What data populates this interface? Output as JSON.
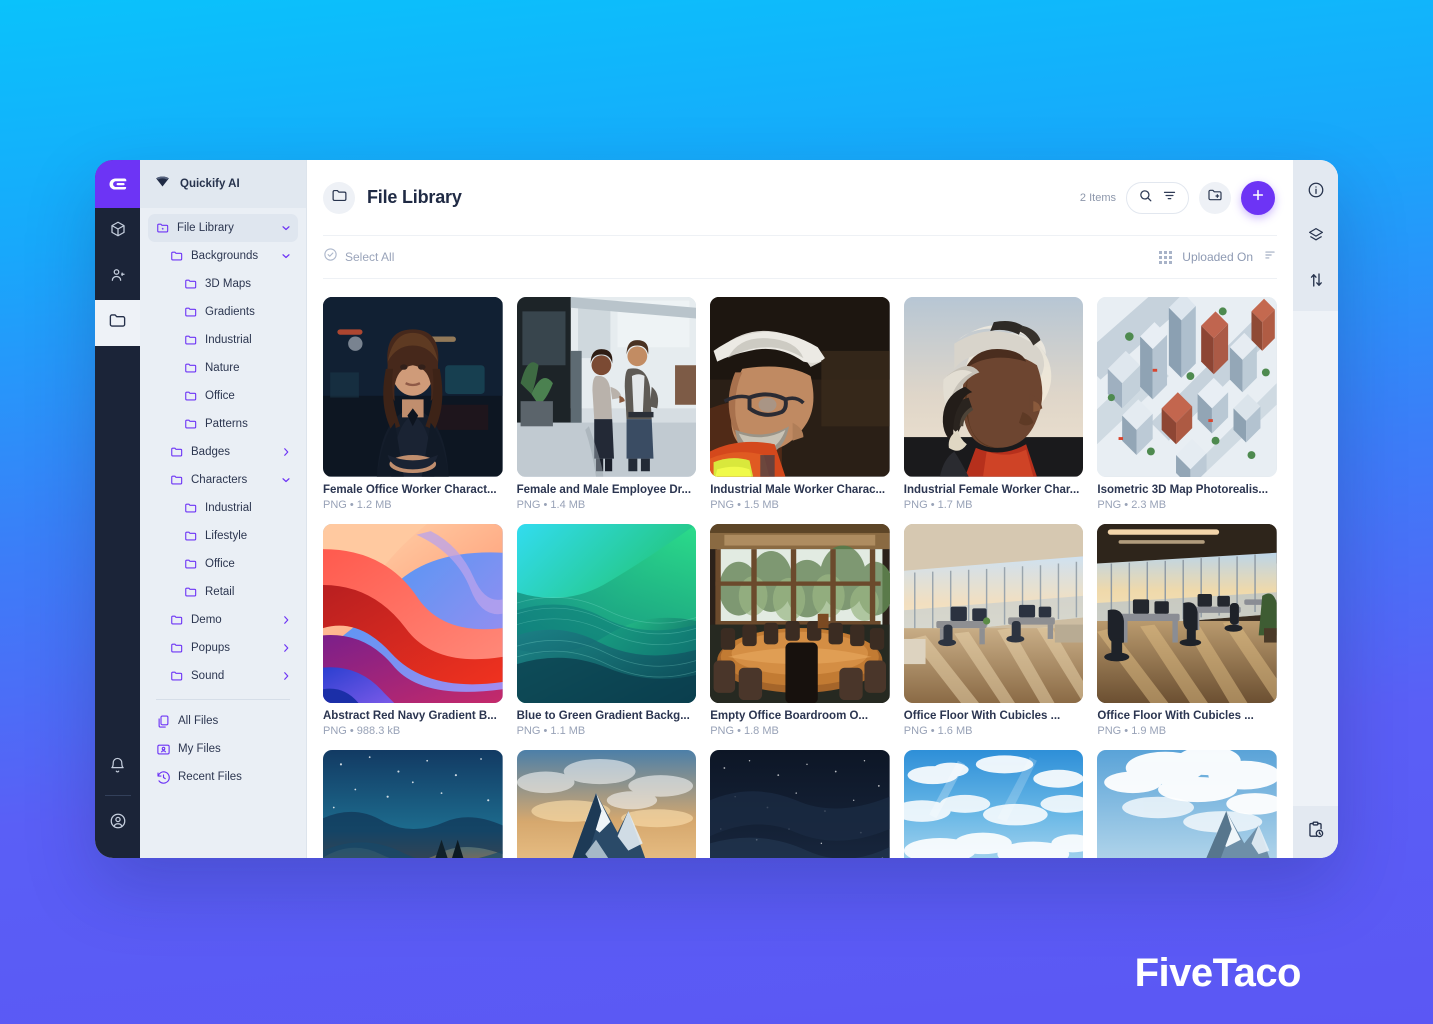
{
  "background": {
    "from": "#0ac2fb",
    "to": "#5b57f4"
  },
  "watermark": {
    "text": "FiveTaco"
  },
  "brand": {
    "name": "Quickify AI",
    "accent": "#6d34f5"
  },
  "left_rail": {
    "items": [
      {
        "name": "logo",
        "icon": "quickify-logo-icon"
      },
      {
        "name": "cube",
        "icon": "cube-icon"
      },
      {
        "name": "people",
        "icon": "people-icon"
      },
      {
        "name": "folder",
        "icon": "folder-icon",
        "active": true
      }
    ],
    "bottom": [
      {
        "name": "notifications",
        "icon": "bell-icon"
      },
      {
        "name": "account",
        "icon": "user-circle-icon"
      }
    ]
  },
  "sidebar": {
    "tree": [
      {
        "label": "File Library",
        "depth": 1,
        "icon": "folder-star-icon",
        "chevron": "down",
        "selected": true
      },
      {
        "label": "Backgrounds",
        "depth": 2,
        "icon": "folder-icon",
        "chevron": "down"
      },
      {
        "label": "3D Maps",
        "depth": 3,
        "icon": "folder-icon",
        "chevron": "none"
      },
      {
        "label": "Gradients",
        "depth": 3,
        "icon": "folder-icon",
        "chevron": "none"
      },
      {
        "label": "Industrial",
        "depth": 3,
        "icon": "folder-icon",
        "chevron": "none"
      },
      {
        "label": "Nature",
        "depth": 3,
        "icon": "folder-icon",
        "chevron": "none"
      },
      {
        "label": "Office",
        "depth": 3,
        "icon": "folder-icon",
        "chevron": "none"
      },
      {
        "label": "Patterns",
        "depth": 3,
        "icon": "folder-icon",
        "chevron": "none"
      },
      {
        "label": "Badges",
        "depth": 2,
        "icon": "folder-icon",
        "chevron": "right"
      },
      {
        "label": "Characters",
        "depth": 2,
        "icon": "folder-icon",
        "chevron": "down"
      },
      {
        "label": "Industrial",
        "depth": 3,
        "icon": "folder-icon",
        "chevron": "none"
      },
      {
        "label": "Lifestyle",
        "depth": 3,
        "icon": "folder-icon",
        "chevron": "none"
      },
      {
        "label": "Office",
        "depth": 3,
        "icon": "folder-icon",
        "chevron": "none"
      },
      {
        "label": "Retail",
        "depth": 3,
        "icon": "folder-icon",
        "chevron": "none"
      },
      {
        "label": "Demo",
        "depth": 2,
        "icon": "folder-icon",
        "chevron": "right"
      },
      {
        "label": "Popups",
        "depth": 2,
        "icon": "folder-icon",
        "chevron": "right"
      },
      {
        "label": "Sound",
        "depth": 2,
        "icon": "folder-icon",
        "chevron": "right"
      }
    ],
    "links": [
      {
        "label": "All Files",
        "icon": "copy-files-icon"
      },
      {
        "label": "My Files",
        "icon": "my-files-icon"
      },
      {
        "label": "Recent Files",
        "icon": "history-clock-icon"
      }
    ]
  },
  "header": {
    "title": "File Library",
    "folder_icon": "folder-icon",
    "item_count": "2 Items",
    "search_icon": "search-icon",
    "filter_icon": "filter-icon",
    "new_folder_icon": "folder-add-icon",
    "add_icon": "plus-icon"
  },
  "subbar": {
    "select_all": "Select All",
    "select_all_icon": "check-circle-icon",
    "view_icon": "grid-view-icon",
    "sort_label": "Uploaded On",
    "sort_icon": "sort-descending-icon"
  },
  "right_rail": {
    "items": [
      {
        "name": "info",
        "icon": "info-circle-icon"
      },
      {
        "name": "layers",
        "icon": "layers-icon"
      },
      {
        "name": "sort",
        "icon": "arrows-up-down-icon"
      }
    ],
    "footer": {
      "name": "activity",
      "icon": "clipboard-clock-icon"
    }
  },
  "files": [
    {
      "name": "Female Office Worker Charact...",
      "meta": "PNG • 1.2 MB",
      "thumb": "portrait-businesswoman"
    },
    {
      "name": "Female and Male Employee Dr...",
      "meta": "PNG • 1.4 MB",
      "thumb": "office-lobby-two-people"
    },
    {
      "name": "Industrial Male Worker Charac...",
      "meta": "PNG • 1.5 MB",
      "thumb": "male-hardhat-worker"
    },
    {
      "name": "Industrial Female Worker Char...",
      "meta": "PNG • 1.7 MB",
      "thumb": "female-hardhat-worker"
    },
    {
      "name": "Isometric 3D Map Photorealis...",
      "meta": "PNG • 2.3 MB",
      "thumb": "isometric-city-map"
    },
    {
      "name": "Abstract Red Navy Gradient B...",
      "meta": "PNG • 988.3 kB",
      "thumb": "red-navy-gradient"
    },
    {
      "name": "Blue to Green Gradient Backg...",
      "meta": "PNG • 1.1 MB",
      "thumb": "blue-green-gradient"
    },
    {
      "name": "Empty Office Boardroom O...",
      "meta": "PNG • 1.8 MB",
      "thumb": "boardroom"
    },
    {
      "name": "Office Floor With Cubicles ...",
      "meta": "PNG • 1.6 MB",
      "thumb": "office-floor-a"
    },
    {
      "name": "Office Floor With Cubicles ...",
      "meta": "PNG • 1.9 MB",
      "thumb": "office-floor-b"
    },
    {
      "name": "",
      "meta": "",
      "thumb": "night-sky-sunset"
    },
    {
      "name": "",
      "meta": "",
      "thumb": "snowy-mountain"
    },
    {
      "name": "",
      "meta": "",
      "thumb": "dark-starry-sky"
    },
    {
      "name": "",
      "meta": "",
      "thumb": "blue-clouds"
    },
    {
      "name": "",
      "meta": "",
      "thumb": "mountain-forest"
    }
  ]
}
